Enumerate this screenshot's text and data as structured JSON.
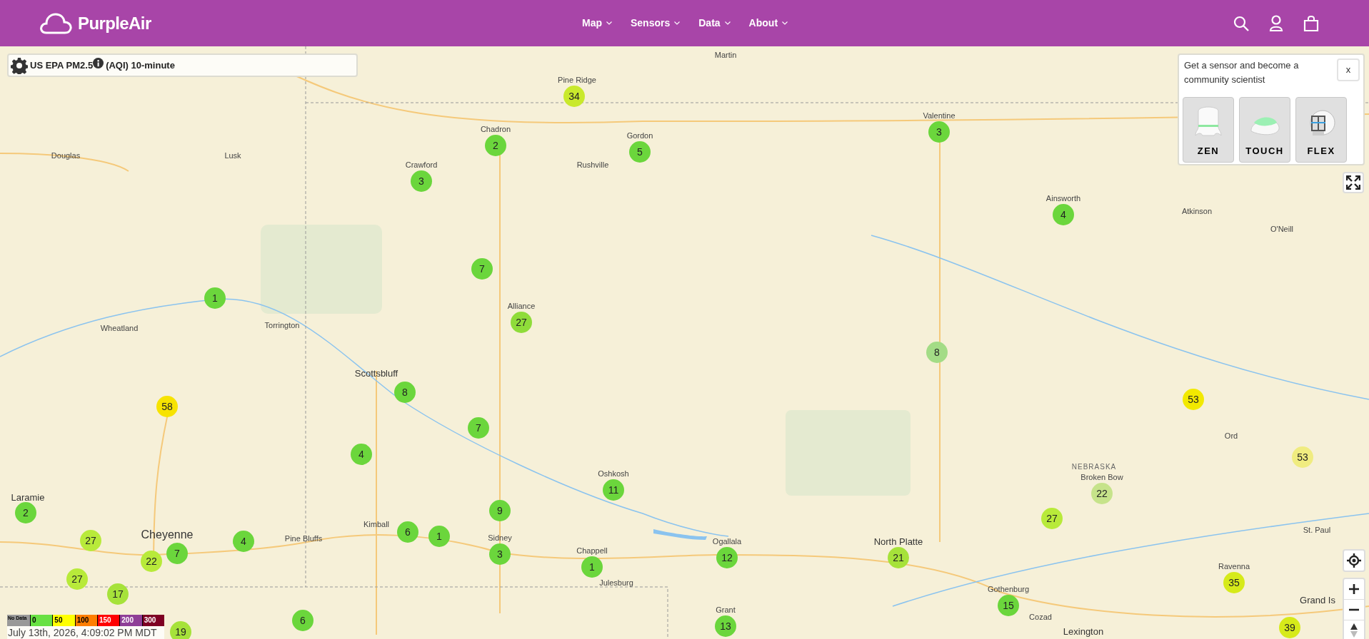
{
  "header": {
    "brand": "PurpleAir",
    "nav": [
      {
        "label": "Map"
      },
      {
        "label": "Sensors"
      },
      {
        "label": "Data"
      },
      {
        "label": "About"
      }
    ]
  },
  "layer_selector": {
    "label": "US EPA PM2.5",
    "suffix": "(AQI) 10-minute"
  },
  "promo": {
    "text": "Get a sensor and become a community scientist",
    "close": "x",
    "products": [
      {
        "kind": "zen",
        "label": "ZEN"
      },
      {
        "kind": "touch",
        "label": "TOUCH"
      },
      {
        "kind": "flex",
        "label": "FLEX"
      }
    ]
  },
  "places": [
    {
      "name": "Martin",
      "kind": "town"
    },
    {
      "name": "Pine Ridge",
      "kind": "town"
    },
    {
      "name": "Chadron",
      "kind": "town"
    },
    {
      "name": "Gordon",
      "kind": "town"
    },
    {
      "name": "Valentine",
      "kind": "town"
    },
    {
      "name": "Douglas",
      "kind": "town"
    },
    {
      "name": "Lusk",
      "kind": "town"
    },
    {
      "name": "Crawford",
      "kind": "town"
    },
    {
      "name": "Rushville",
      "kind": "town"
    },
    {
      "name": "Ainsworth",
      "kind": "town"
    },
    {
      "name": "Atkinson",
      "kind": "town"
    },
    {
      "name": "O'Neill",
      "kind": "town"
    },
    {
      "name": "Alliance",
      "kind": "town"
    },
    {
      "name": "Torrington",
      "kind": "town"
    },
    {
      "name": "Wheatland",
      "kind": "town"
    },
    {
      "name": "Scottsbluff",
      "kind": "city"
    },
    {
      "name": "NEBRASKA",
      "kind": "state"
    },
    {
      "name": "Ord",
      "kind": "town"
    },
    {
      "name": "Broken Bow",
      "kind": "town"
    },
    {
      "name": "Oshkosh",
      "kind": "town"
    },
    {
      "name": "Laramie",
      "kind": "city"
    },
    {
      "name": "Kimball",
      "kind": "town"
    },
    {
      "name": "Pine Bluffs",
      "kind": "town"
    },
    {
      "name": "St. Paul",
      "kind": "town"
    },
    {
      "name": "Cheyenne",
      "kind": "bigcity"
    },
    {
      "name": "Sidney",
      "kind": "town"
    },
    {
      "name": "Ogallala",
      "kind": "town"
    },
    {
      "name": "North Platte",
      "kind": "city"
    },
    {
      "name": "Chappell",
      "kind": "town"
    },
    {
      "name": "Julesburg",
      "kind": "town"
    },
    {
      "name": "Ravenna",
      "kind": "town"
    },
    {
      "name": "Gothenburg",
      "kind": "town"
    },
    {
      "name": "Grand Is",
      "kind": "city"
    },
    {
      "name": "Cozad",
      "kind": "town"
    },
    {
      "name": "Grant",
      "kind": "town"
    },
    {
      "name": "Lexington",
      "kind": "city"
    }
  ],
  "sensors": [
    {
      "value": "34",
      "color": "#c9e92c"
    },
    {
      "value": "2",
      "color": "#6bd63c"
    },
    {
      "value": "5",
      "color": "#6bd63c"
    },
    {
      "value": "3",
      "color": "#6bd63c"
    },
    {
      "value": "3",
      "color": "#6bd63c"
    },
    {
      "value": "4",
      "color": "#6bd63c"
    },
    {
      "value": "7",
      "color": "#6bd63c"
    },
    {
      "value": "1",
      "color": "#6bd63c"
    },
    {
      "value": "27",
      "color": "#8fdc3a"
    },
    {
      "value": "8",
      "color": "#a3dc86"
    },
    {
      "value": "53",
      "color": "#f2e900"
    },
    {
      "value": "53",
      "color": "#f0ec80"
    },
    {
      "value": "58",
      "color": "#f7e300"
    },
    {
      "value": "8",
      "color": "#6bd63c"
    },
    {
      "value": "7",
      "color": "#6bd63c"
    },
    {
      "value": "4",
      "color": "#6bd63c"
    },
    {
      "value": "11",
      "color": "#6bd63c"
    },
    {
      "value": "22",
      "color": "#c6e38a"
    },
    {
      "value": "9",
      "color": "#6bd63c"
    },
    {
      "value": "27",
      "color": "#b8ea3a"
    },
    {
      "value": "2",
      "color": "#6bd63c"
    },
    {
      "value": "6",
      "color": "#6bd63c"
    },
    {
      "value": "1",
      "color": "#6bd63c"
    },
    {
      "value": "27",
      "color": "#b8ea3a"
    },
    {
      "value": "4",
      "color": "#6bd63c"
    },
    {
      "value": "7",
      "color": "#6bd63c"
    },
    {
      "value": "22",
      "color": "#b8ea3a"
    },
    {
      "value": "3",
      "color": "#6bd63c"
    },
    {
      "value": "1",
      "color": "#6bd63c"
    },
    {
      "value": "12",
      "color": "#6bd63c"
    },
    {
      "value": "21",
      "color": "#a6e23a"
    },
    {
      "value": "27",
      "color": "#b8ea3a"
    },
    {
      "value": "35",
      "color": "#d6ea1a"
    },
    {
      "value": "17",
      "color": "#a6e23a"
    },
    {
      "value": "15",
      "color": "#6bd63c"
    },
    {
      "value": "6",
      "color": "#6bd63c"
    },
    {
      "value": "13",
      "color": "#6bd63c"
    },
    {
      "value": "39",
      "color": "#d6ea1a"
    },
    {
      "value": "19",
      "color": "#a6e23a"
    }
  ],
  "legend": {
    "scale": [
      {
        "label": "No Data",
        "color": "#999999"
      },
      {
        "label": "0",
        "color": "#68e143"
      },
      {
        "label": "50",
        "color": "#ffff00"
      },
      {
        "label": "100",
        "color": "#ff7e00"
      },
      {
        "label": "150",
        "color": "#ff0000"
      },
      {
        "label": "200",
        "color": "#8f3f97"
      },
      {
        "label": "300",
        "color": "#7e0023"
      }
    ],
    "timestamp": "July 13th, 2026, 4:09:02 PM MDT"
  }
}
